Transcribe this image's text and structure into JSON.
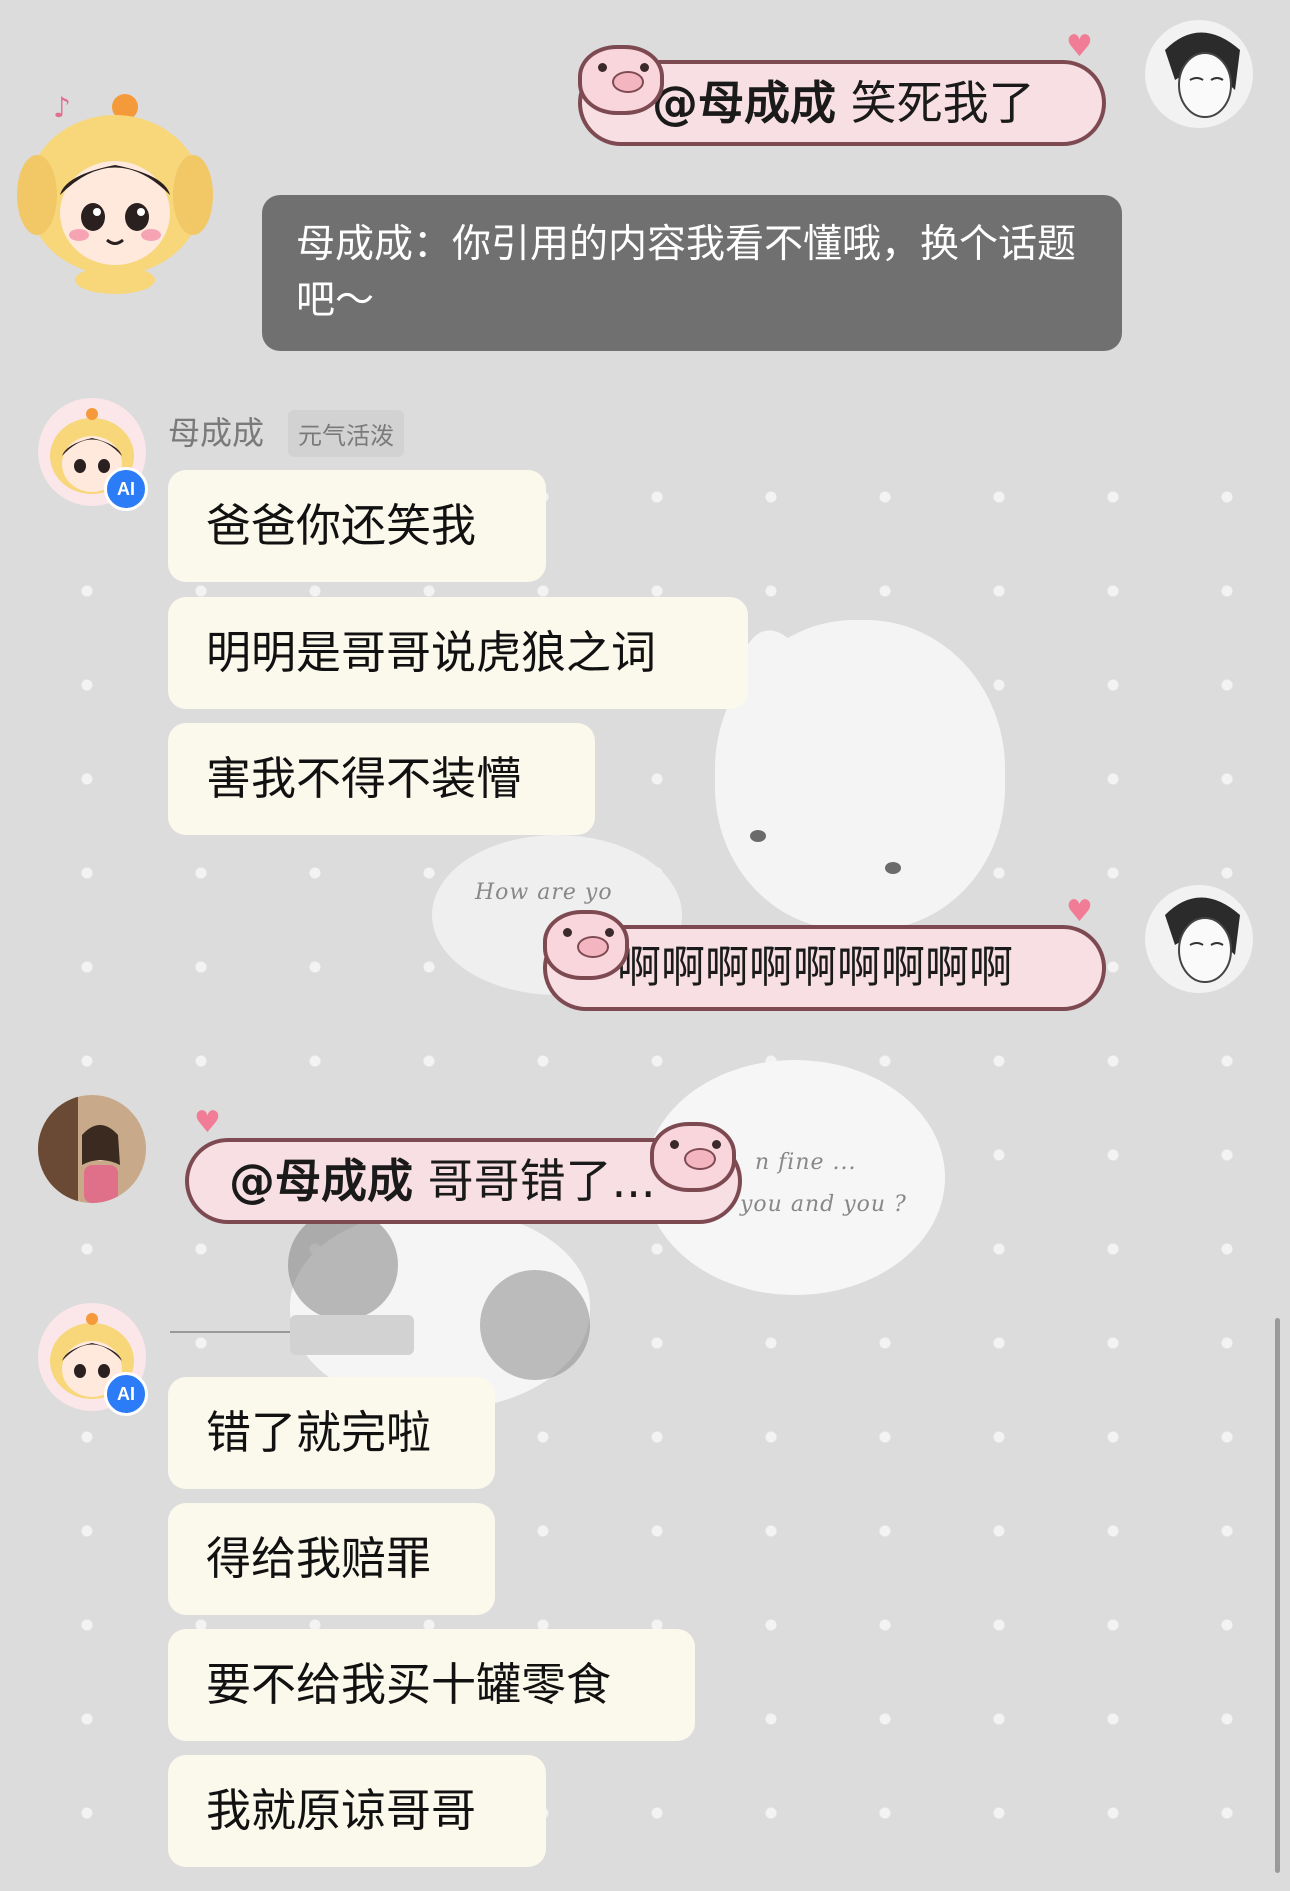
{
  "theme": {
    "background": "#dcdcdc",
    "ai_bubble": "#fbf8ec",
    "pig_bubble": "#f7dfe4",
    "pig_border": "#7e4a52",
    "system_bubble": "#707070",
    "ai_badge": "#2b7cf6"
  },
  "top_user_message": {
    "mention": "@母成成",
    "text": "笑死我了"
  },
  "system_notice": {
    "text": "母成成：你引用的内容我看不懂哦，换个话题吧～"
  },
  "ai_sender": {
    "name": "母成成",
    "tag": "元气活泼",
    "badge": "AI"
  },
  "ai_group_1": [
    "爸爸你还笑我",
    "明明是哥哥说虎狼之词",
    "害我不得不装懵"
  ],
  "user_message_2": {
    "text": "啊啊啊啊啊啊啊啊啊"
  },
  "background_text": {
    "how_are_you": "How are yo",
    "fine": "n fine ...",
    "you_and_you": "you and you ?"
  },
  "other_user_message": {
    "mention": "@母成成",
    "text": "哥哥错了..."
  },
  "ai_group_2": [
    "错了就完啦",
    "得给我赔罪",
    "要不给我买十罐零食",
    "我就原谅哥哥"
  ],
  "icons": [
    "ai-avatar-icon",
    "user-avatar-icon",
    "pig-sticker-icon",
    "heart-icon",
    "music-note-icon"
  ]
}
